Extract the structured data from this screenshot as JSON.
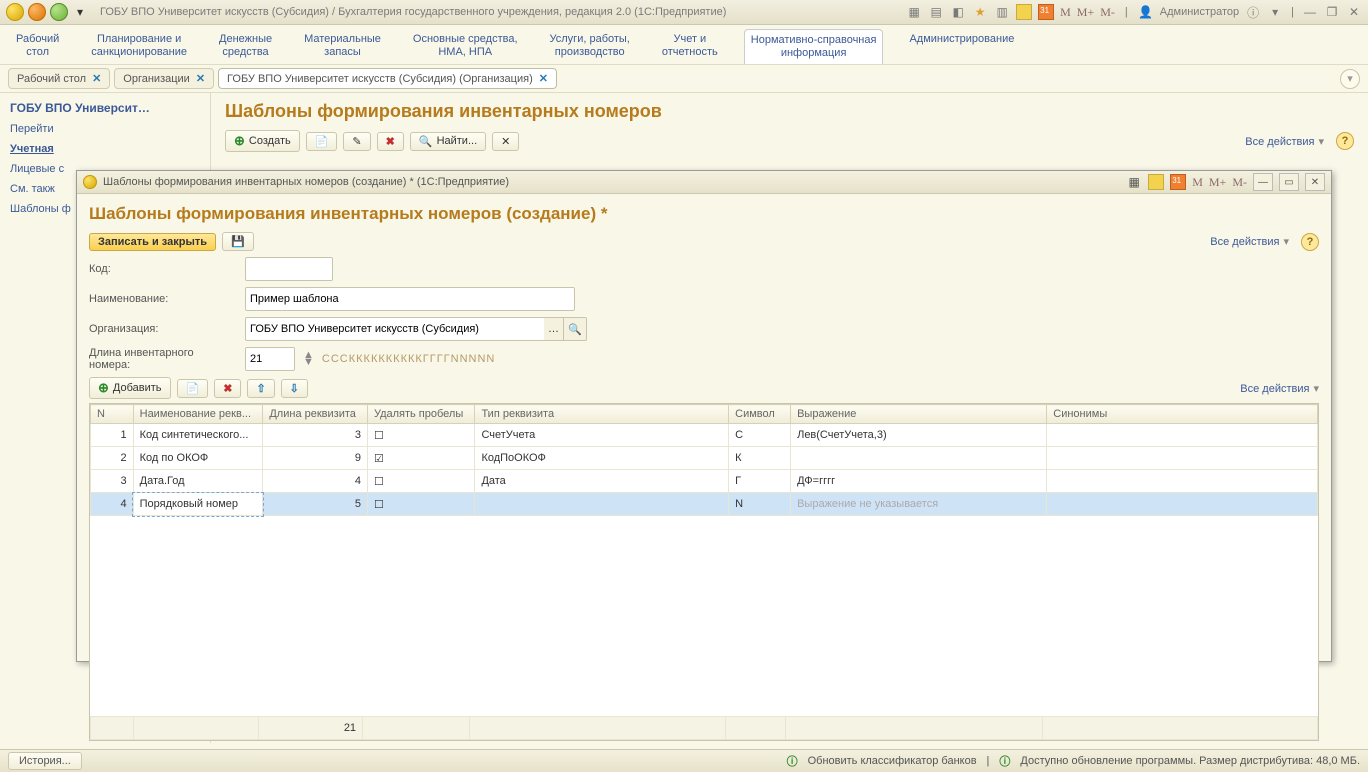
{
  "titlebar": {
    "title": "ГОБУ ВПО Университет искусств (Субсидия) / Бухгалтерия государственного учреждения, редакция 2.0  (1С:Предприятие)",
    "user": "Администратор",
    "m_labels": [
      "M",
      "M+",
      "M-"
    ]
  },
  "sections": [
    {
      "l1": "Рабочий",
      "l2": "стол"
    },
    {
      "l1": "Планирование и",
      "l2": "санкционирование"
    },
    {
      "l1": "Денежные",
      "l2": "средства"
    },
    {
      "l1": "Материальные",
      "l2": "запасы"
    },
    {
      "l1": "Основные средства,",
      "l2": "НМА, НПА"
    },
    {
      "l1": "Услуги, работы,",
      "l2": "производство"
    },
    {
      "l1": "Учет и",
      "l2": "отчетность"
    },
    {
      "l1": "Нормативно-справочная",
      "l2": "информация",
      "active": true
    },
    {
      "l1": "Администрирование",
      "l2": ""
    }
  ],
  "tabs": [
    {
      "label": "Рабочий стол",
      "close": true
    },
    {
      "label": "Организации",
      "close": true
    },
    {
      "label": "ГОБУ ВПО Университет искусств (Субсидия) (Организация)",
      "close": true,
      "active": true
    }
  ],
  "left": {
    "header": "ГОБУ ВПО Университ…",
    "items": [
      "Перейти",
      "Учетная",
      "Лицевые с",
      "См. такж",
      "Шаблоны ф"
    ],
    "active_index": 1
  },
  "page": {
    "title": "Шаблоны формирования инвентарных номеров",
    "create": "Создать",
    "find": "Найти...",
    "all_actions": "Все действия"
  },
  "dialog": {
    "wintitle": "Шаблоны формирования инвентарных номеров (создание) *  (1С:Предприятие)",
    "title": "Шаблоны формирования инвентарных номеров (создание) *",
    "save_close": "Записать и закрыть",
    "all_actions": "Все действия",
    "fields": {
      "code_label": "Код:",
      "code_value": "",
      "name_label": "Наименование:",
      "name_value": "Пример шаблона",
      "org_label": "Организация:",
      "org_value": "ГОБУ ВПО Университет искусств (Субсидия)",
      "len_label": "Длина инвентарного номера:",
      "len_value": "21",
      "mask": "СССККККККККККГГГГNNNNN"
    },
    "grid_toolbar": {
      "add": "Добавить",
      "all_actions": "Все действия"
    },
    "grid": {
      "headers": [
        "N",
        "Наименование рекв...",
        "Длина реквизита",
        "Удалять пробелы",
        "Тип реквизита",
        "Символ",
        "Выражение",
        "Синонимы"
      ],
      "rows": [
        {
          "n": "1",
          "name": "Код синтетического...",
          "len": "3",
          "trim": false,
          "type": "СчетУчета",
          "sym": "С",
          "expr": "Лев(СчетУчета,3)",
          "syn": ""
        },
        {
          "n": "2",
          "name": "Код по ОКОФ",
          "len": "9",
          "trim": true,
          "type": "КодПоОКОФ",
          "sym": "К",
          "expr": "",
          "syn": ""
        },
        {
          "n": "3",
          "name": "Дата.Год",
          "len": "4",
          "trim": false,
          "type": "Дата",
          "sym": "Г",
          "expr": "ДФ=гггг",
          "syn": ""
        },
        {
          "n": "4",
          "name": "Порядковый номер",
          "len": "5",
          "trim": false,
          "type": "",
          "sym": "N",
          "expr": "Выражение не указывается",
          "syn": "",
          "selected": true,
          "placeholder_expr": true
        }
      ],
      "footer_len": "21"
    },
    "m_labels": [
      "M",
      "M+",
      "M-"
    ]
  },
  "statusbar": {
    "history": "История...",
    "msg1": "Обновить классификатор банков",
    "msg2": "Доступно обновление программы. Размер дистрибутива: 48,0 МБ."
  }
}
